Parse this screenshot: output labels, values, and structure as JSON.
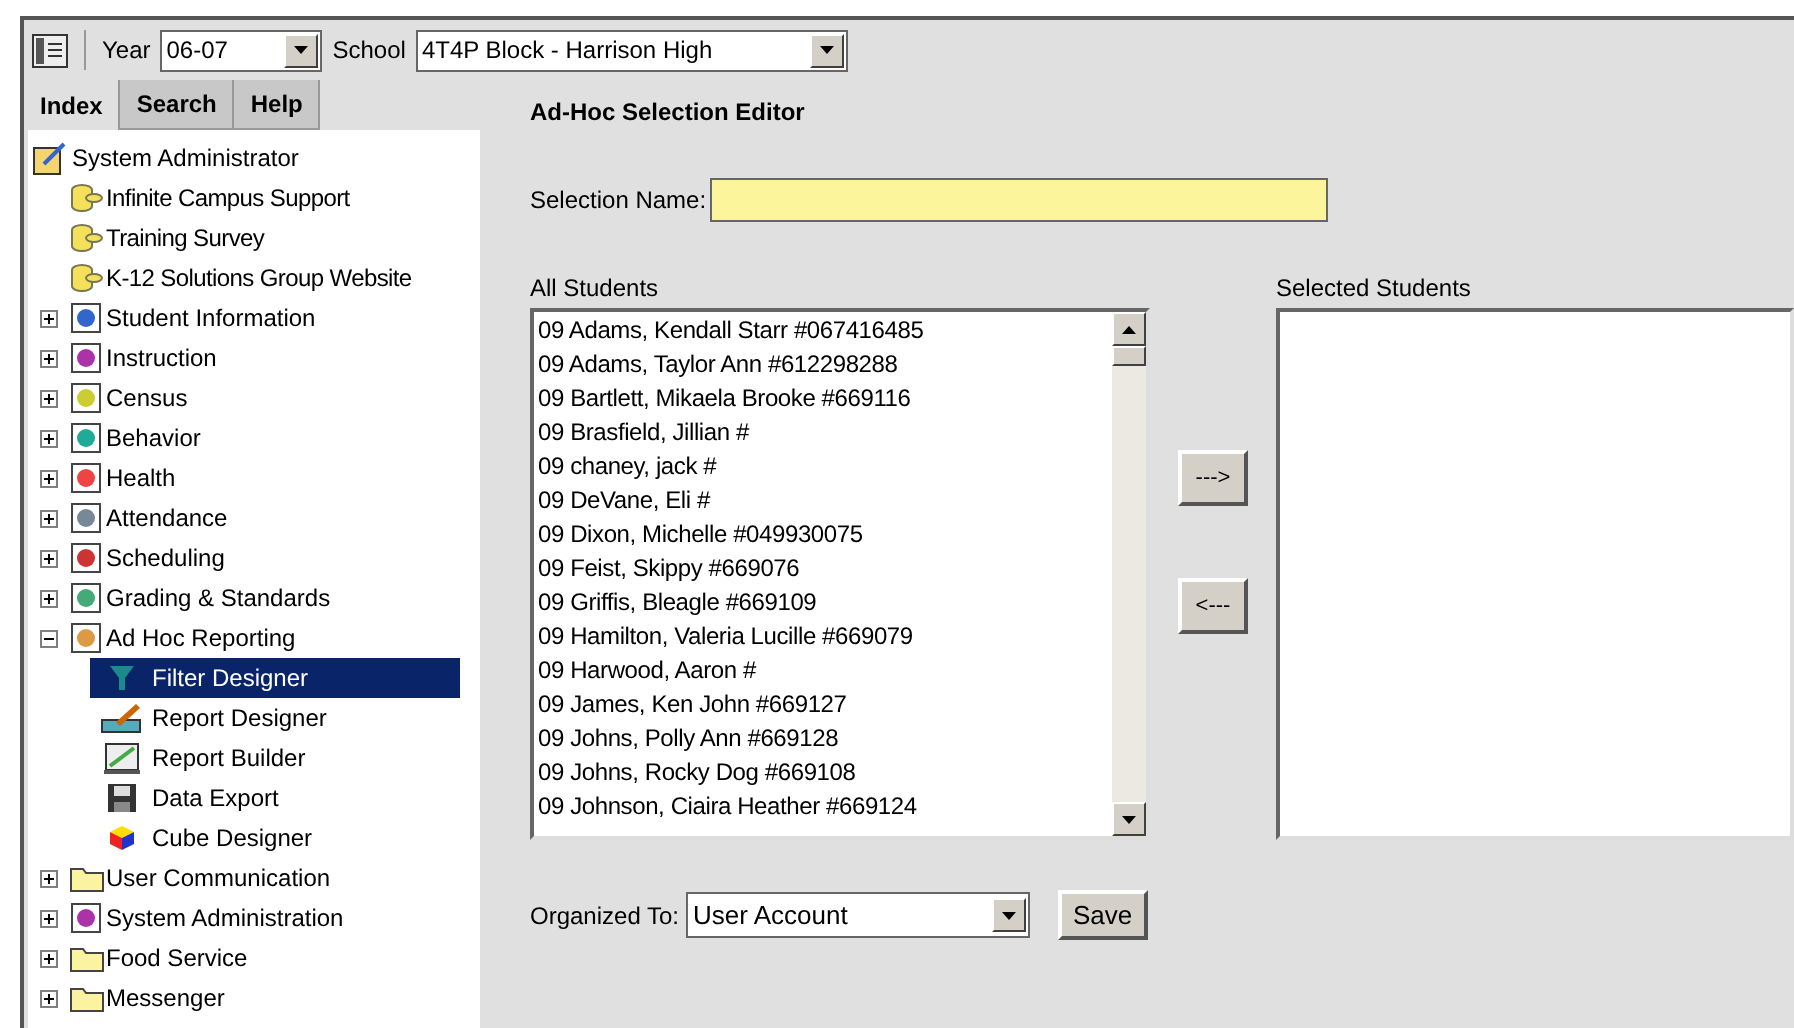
{
  "toolbar": {
    "year_label": "Year",
    "year": "06-07",
    "school_label": "School",
    "school": "4T4P Block - Harrison High"
  },
  "tabs": [
    {
      "label": "Index",
      "selected": true
    },
    {
      "label": "Search",
      "selected": false
    },
    {
      "label": "Help",
      "selected": false
    }
  ],
  "tree": {
    "label": "System Administrator",
    "children": [
      {
        "label": "Infinite Campus Support",
        "kind": "leaf",
        "selected": false
      },
      {
        "label": "Training Survey",
        "kind": "leaf",
        "selected": false
      },
      {
        "label": "K-12 Solutions Group Website",
        "kind": "leaf",
        "selected": false
      },
      {
        "label": "Student Information",
        "kind": "group",
        "expanded": false
      },
      {
        "label": "Instruction",
        "kind": "group",
        "expanded": false
      },
      {
        "label": "Census",
        "kind": "group",
        "expanded": false
      },
      {
        "label": "Behavior",
        "kind": "group",
        "expanded": false
      },
      {
        "label": "Health",
        "kind": "group",
        "expanded": false
      },
      {
        "label": "Attendance",
        "kind": "group",
        "expanded": false
      },
      {
        "label": "Scheduling",
        "kind": "group",
        "expanded": false
      },
      {
        "label": "Grading & Standards",
        "kind": "group",
        "expanded": false
      },
      {
        "label": "Ad Hoc Reporting",
        "kind": "group",
        "expanded": true,
        "children": [
          {
            "label": "Filter Designer",
            "selected": true
          },
          {
            "label": "Report Designer",
            "selected": false
          },
          {
            "label": "Report Builder",
            "selected": false
          },
          {
            "label": "Data Export",
            "selected": false
          },
          {
            "label": "Cube Designer",
            "selected": false
          }
        ]
      },
      {
        "label": "User Communication",
        "kind": "group",
        "expanded": false
      },
      {
        "label": "System Administration",
        "kind": "group",
        "expanded": false
      },
      {
        "label": "Food Service",
        "kind": "group",
        "expanded": false
      },
      {
        "label": "Messenger",
        "kind": "group",
        "expanded": false
      }
    ]
  },
  "editor": {
    "title": "Ad-Hoc Selection Editor",
    "selection_name_label": "Selection Name:",
    "all_students_label": "All Students",
    "selected_students_label": "Selected Students",
    "all_students": [
      "09 Adams, Kendall Starr #067416485",
      "09 Adams, Taylor Ann #612298288",
      "09 Bartlett, Mikaela Brooke #669116",
      "09 Brasfield, Jillian  #",
      "09 chaney, jack  #",
      "09 DeVane, Eli  #",
      "09 Dixon, Michelle  #049930075",
      "09 Feist, Skippy  #669076",
      "09 Griffis, Bleagle  #669109",
      "09 Hamilton, Valeria Lucille #669079",
      "09 Harwood, Aaron  #",
      "09 James, Ken John #669127",
      "09 Johns, Polly Ann #669128",
      "09 Johns, Rocky Dog #669108",
      "09 Johnson, Ciaira Heather #669124"
    ],
    "add_button": "--->",
    "remove_button": "<---",
    "organized_label": "Organized To:",
    "organized_value": "User Account",
    "save_button": "Save"
  }
}
